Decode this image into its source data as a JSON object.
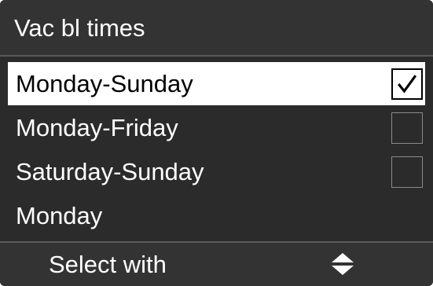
{
  "header": {
    "title": "Vac bl times"
  },
  "options": [
    {
      "label": "Monday-Sunday",
      "checked": true,
      "highlighted": true,
      "show_checkbox": true
    },
    {
      "label": "Monday-Friday",
      "checked": false,
      "highlighted": false,
      "show_checkbox": true
    },
    {
      "label": "Saturday-Sunday",
      "checked": false,
      "highlighted": false,
      "show_checkbox": true
    },
    {
      "label": "Monday",
      "checked": false,
      "highlighted": false,
      "show_checkbox": false
    }
  ],
  "footer": {
    "hint": "Select with",
    "icon": "up-down-arrows-icon"
  },
  "colors": {
    "background": "#2b2b2b",
    "bar_background": "#333333",
    "highlight": "#ffffff",
    "separator": "#5a5a5a"
  }
}
